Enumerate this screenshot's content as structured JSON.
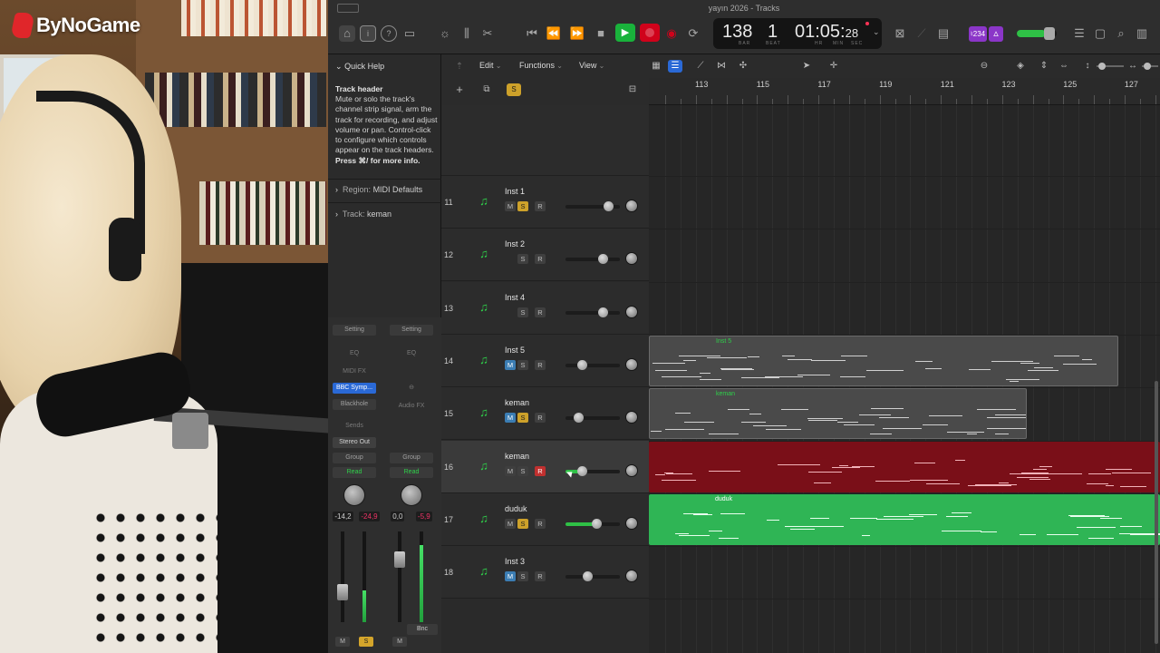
{
  "overlay": {
    "brand": "ByNoGame"
  },
  "window": {
    "title": "yayın 2026 - Tracks"
  },
  "transport": {
    "tempo": "138",
    "beat": "1",
    "time_main": "01:05:",
    "time_frames": "28",
    "label_bar": "BAR",
    "label_beat": "BEAT",
    "label_hr": "HR",
    "label_min": "MIN",
    "label_sec": "SEC",
    "count_badge": "♮234"
  },
  "quick_help": {
    "header": "Quick Help",
    "title": "Track header",
    "body": "Mute or solo the track's channel strip signal, arm the track for recording, and adjust volume or pan. Control-click to configure which controls appear on the track headers.",
    "more": "Press ⌘/ for more info."
  },
  "inspector": {
    "region_label": "Region:",
    "region_value": "MIDI Defaults",
    "track_label": "Track:",
    "track_value": "keman"
  },
  "channel_strips": [
    {
      "setting": "Setting",
      "eq": "EQ",
      "midi_fx": "MIDI FX",
      "plugin": "BBC Symp...",
      "send": "Blackhole",
      "sends": "Sends",
      "output": "Stereo Out",
      "group": "Group",
      "automation": "Read",
      "db_value": "-14,2",
      "db_peak": "-24,9",
      "fader_level": 0.34,
      "meter_level": 0.35,
      "m": "M",
      "s": "S"
    },
    {
      "setting": "Setting",
      "eq": "EQ",
      "audio_fx": "Audio FX",
      "group": "Group",
      "automation": "Read",
      "db_value": "0,0",
      "db_peak": "-5,9",
      "fader_level": 0.75,
      "meter_level": 0.85,
      "bnc": "Bnc",
      "m": "M"
    }
  ],
  "arrange_toolbar": {
    "edit": "Edit",
    "functions": "Functions",
    "view": "View"
  },
  "ruler": [
    "113",
    "115",
    "117",
    "119",
    "121",
    "123",
    "125",
    "127"
  ],
  "tracks": [
    {
      "num": "11",
      "name": "Inst 1",
      "m": "M",
      "s": "S",
      "r": "R",
      "m_on": false,
      "s_on": true,
      "r_on": false,
      "volume": 0.78
    },
    {
      "num": "12",
      "name": "Inst 2",
      "m": "",
      "s": "S",
      "r": "R",
      "m_on": false,
      "s_on": false,
      "r_on": false,
      "volume": 0.68
    },
    {
      "num": "13",
      "name": "Inst 4",
      "m": "",
      "s": "S",
      "r": "R",
      "m_on": false,
      "s_on": false,
      "r_on": false,
      "volume": 0.68
    },
    {
      "num": "14",
      "name": "Inst 5",
      "m": "M",
      "s": "S",
      "r": "R",
      "m_on": true,
      "s_on": false,
      "r_on": false,
      "volume": 0.3
    },
    {
      "num": "15",
      "name": "keman",
      "m": "M",
      "s": "S",
      "r": "R",
      "m_on": true,
      "s_on": true,
      "r_on": false,
      "volume": 0.24
    },
    {
      "num": "16",
      "name": "keman",
      "m": "M",
      "s": "S",
      "r": "R",
      "m_on": false,
      "s_on": false,
      "r_on": true,
      "volume": 0.3
    },
    {
      "num": "17",
      "name": "duduk",
      "m": "M",
      "s": "S",
      "r": "R",
      "m_on": false,
      "s_on": true,
      "r_on": false,
      "volume": 0.57
    },
    {
      "num": "18",
      "name": "Inst 3",
      "m": "M",
      "s": "S",
      "r": "R",
      "m_on": true,
      "s_on": false,
      "r_on": false,
      "volume": 0.4
    }
  ],
  "regions": [
    {
      "name": "Inst 5",
      "color": "#4a4a4a",
      "text_color": "#2fd04a"
    },
    {
      "name": "keman",
      "color": "#4a4a4a",
      "text_color": "#2fd04a"
    },
    {
      "name": "",
      "color": "#7a0f18",
      "text_color": "#ffffff"
    },
    {
      "name": "duduk",
      "color": "#2fb555",
      "text_color": "#ffffff"
    }
  ],
  "colors": {
    "play": "#19b23b",
    "record": "#d0021b",
    "solo": "#cda12a",
    "mute": "#3b7db3",
    "plugin": "#2a69d6"
  }
}
